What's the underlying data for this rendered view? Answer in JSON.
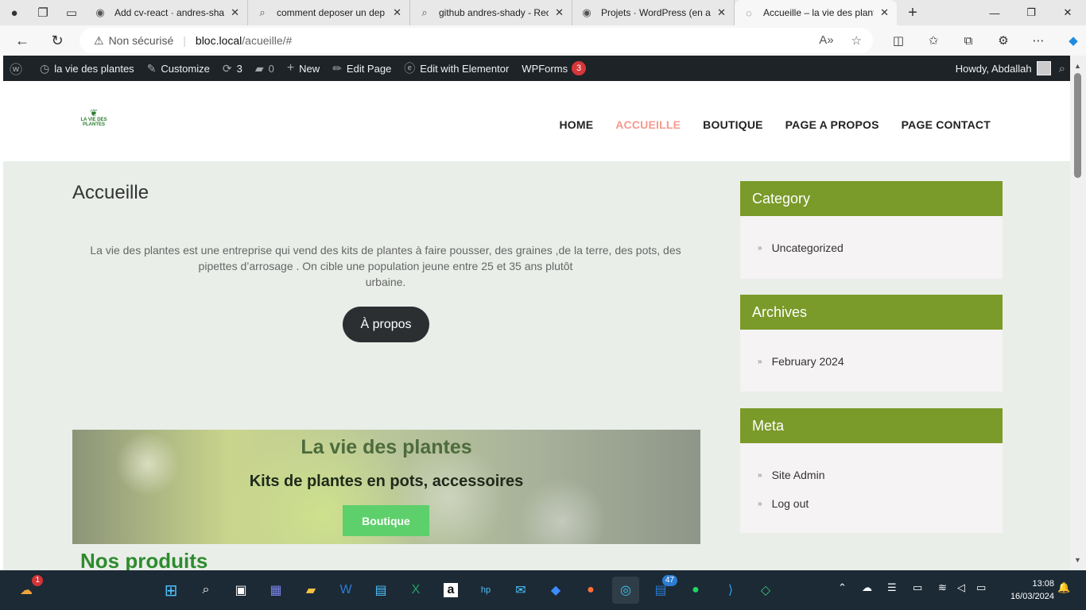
{
  "browser": {
    "tabs": [
      {
        "title": "Add cv-react · andres-shad",
        "favicon": "github-icon"
      },
      {
        "title": "comment deposer un dep",
        "favicon": "search-icon"
      },
      {
        "title": "github andres-shady - Rec",
        "favicon": "search-icon"
      },
      {
        "title": "Projets · WordPress (en ar",
        "favicon": "github-icon"
      },
      {
        "title": "Accueille – la vie des plant",
        "favicon": "loading-icon",
        "active": true
      }
    ],
    "address": {
      "security_label": "Non sécurisé",
      "host": "bloc.local",
      "path": "/acueille/#"
    }
  },
  "adminbar": {
    "site_name": "la vie des plantes",
    "customize": "Customize",
    "updates": "3",
    "comments": "0",
    "new": "New",
    "edit_page": "Edit Page",
    "elementor": "Edit with Elementor",
    "wpforms": "WPForms",
    "wpforms_badge": "3",
    "howdy": "Howdy, Abdallah"
  },
  "header": {
    "logo_text": "LA VIE DES PLANTES",
    "nav": [
      "HOME",
      "ACCUEILLE",
      "BOUTIQUE",
      "PAGE A PROPOS",
      "PAGE CONTACT"
    ],
    "current_nav": "ACCUEILLE"
  },
  "main": {
    "title": "Accueille",
    "intro_line1": "La vie des plantes est une entreprise qui vend des kits de plantes à faire pousser, des graines ,de la terre, des pots, des",
    "intro_line2": "pipettes d’arrosage . On cible une population jeune entre 25 et 35 ans plutôt",
    "intro_line3": "urbaine.",
    "apropos_button": "À propos",
    "banner_title": "La vie des plantes",
    "banner_subtitle": "Kits de plantes en pots, accessoires",
    "boutique_button": "Boutique",
    "products_heading": "Nos produits"
  },
  "sidebar": {
    "category": {
      "title": "Category",
      "items": [
        "Uncategorized"
      ]
    },
    "archives": {
      "title": "Archives",
      "items": [
        "February 2024"
      ]
    },
    "meta": {
      "title": "Meta",
      "items": [
        "Site Admin",
        "Log out"
      ]
    }
  },
  "taskbar": {
    "widgets_badge": "1",
    "mail_badge": "47",
    "time": "13:08",
    "date": "16/03/2024"
  },
  "colors": {
    "accent_green": "#7a9a29",
    "nav_current": "#f49a8e",
    "content_bg": "#e9eee9",
    "adminbar_bg": "#1d2327",
    "boutique_btn": "#5dd06b"
  }
}
